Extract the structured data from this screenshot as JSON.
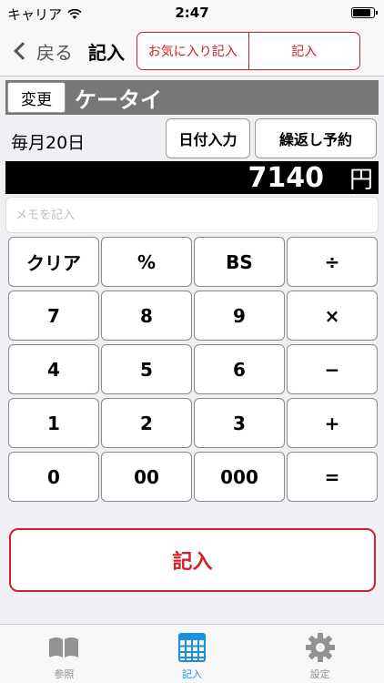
{
  "status_bar": {
    "carrier": "キャリア",
    "time": "2:47",
    "battery_level": 0.9
  },
  "nav": {
    "back_label": "戻る",
    "title": "記入",
    "segments": [
      "お気に入り記入",
      "記入"
    ]
  },
  "category": {
    "change_label": "変更",
    "name": "ケータイ"
  },
  "schedule": {
    "recurrence": "毎月20日",
    "date_button": "日付入力",
    "repeat_button": "繰返し予約"
  },
  "amount": {
    "value": "7140",
    "unit": "円"
  },
  "memo": {
    "placeholder": "メモを記入",
    "value": ""
  },
  "keypad": {
    "keys": [
      "クリア",
      "%",
      "BS",
      "÷",
      "7",
      "8",
      "9",
      "×",
      "4",
      "5",
      "6",
      "−",
      "1",
      "2",
      "3",
      "+",
      "0",
      "00",
      "000",
      "="
    ]
  },
  "submit_label": "記入",
  "tabs": [
    {
      "label": "参照",
      "icon": "book-icon",
      "active": false
    },
    {
      "label": "記入",
      "icon": "calculator-icon",
      "active": true
    },
    {
      "label": "設定",
      "icon": "gear-icon",
      "active": false
    }
  ],
  "colors": {
    "accent": "#d0202a",
    "tab_active": "#1a8fe0",
    "tab_inactive": "#929292"
  }
}
